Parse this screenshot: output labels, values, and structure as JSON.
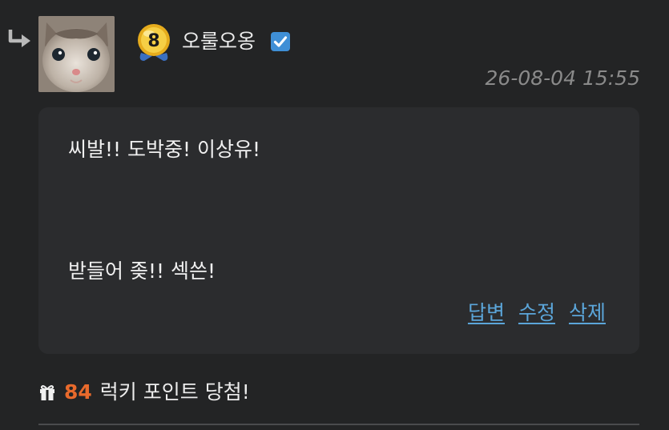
{
  "comment": {
    "user": {
      "nickname": "오룰오옹",
      "level": "8"
    },
    "timestamp": "26-08-04 15:55",
    "body_lines": [
      "씨발!! 도박중! 이상유!",
      "받들어 좆!! 섹쓴!"
    ],
    "actions": {
      "reply_label": "답변",
      "edit_label": "수정",
      "delete_label": "삭제"
    }
  },
  "lucky": {
    "points": "84",
    "text": "럭키 포인트 당첨!"
  },
  "colors": {
    "background": "#232425",
    "card": "#2b2c2e",
    "link": "#5ba6da",
    "points": "#e86a2c",
    "verified": "#3f8fd6",
    "timestamp": "#8a8a8a"
  },
  "icons": {
    "reply": "reply-arrow-icon",
    "verified": "verified-check-icon",
    "gift": "gift-icon",
    "level": "level-badge-icon"
  }
}
